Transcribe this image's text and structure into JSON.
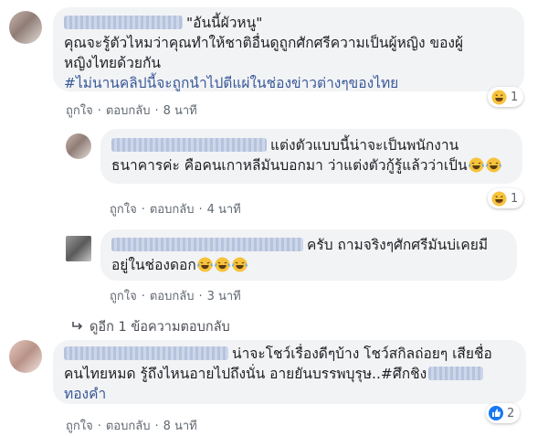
{
  "comments": [
    {
      "header_text": "\"อันนี้ผัวหนู\"",
      "lines": [
        "คุณจะรู้ตัวไหมว่าคุณทำให้ชาติอื่นดูถูกศักศรีความเป็นผู้หญิง ของผู้",
        "หญิงไทยด้วยกัน"
      ],
      "hashtag": "#ไม่นานคลิปนี้จะถูกนำไปตีแผ่ในช่องข่าวต่างๆของไทย",
      "like_label": "ถูกใจ",
      "reply_label": "ตอบกลับ",
      "time": "8 นาที",
      "reaction_icon": "haha-emoji",
      "reaction_count": "1"
    },
    {
      "lines": [
        "แต่งตัวแบบนี้น่าจะเป็นพนักงาน",
        "ธนาคารค่ะ คือคนเกาหลีมันบอกมา ว่าแต่งตัวกู้รู้แล้วว่าเป็น"
      ],
      "like_label": "ถูกใจ",
      "reply_label": "ตอบกลับ",
      "time": "4 นาที",
      "reaction_icon": "haha-emoji",
      "reaction_count": "1"
    },
    {
      "lines": [
        "ครับ ถามจริงๆศักศรีมันบ่เคยมี",
        "อยู่ในช่องดอก"
      ],
      "like_label": "ถูกใจ",
      "reply_label": "ตอบกลับ",
      "time": "3 นาที"
    },
    {
      "lines": [
        "น่าจะโชว์เรื่องดีๆบ้าง โชว์สกิลถ่อยๆ เสียชื่อ",
        "คนไทยหมด รู้ถึงไหนอายไปถึงนั่น อายยันบรรพบุรุษ..#ศึกชิง",
        "ทองคำ"
      ],
      "like_label": "ถูกใจ",
      "reply_label": "ตอบกลับ",
      "time": "8 นาที",
      "reaction_icon": "like-thumb",
      "reaction_count": "2"
    }
  ],
  "more_replies": "ดูอีก 1 ข้อความตอบกลับ",
  "colors": {
    "bubble": "#f2f3f5",
    "link": "#385898",
    "meta": "#606770",
    "like_blue": "#1877f2",
    "emoji_yellow": "#f7c33c"
  }
}
